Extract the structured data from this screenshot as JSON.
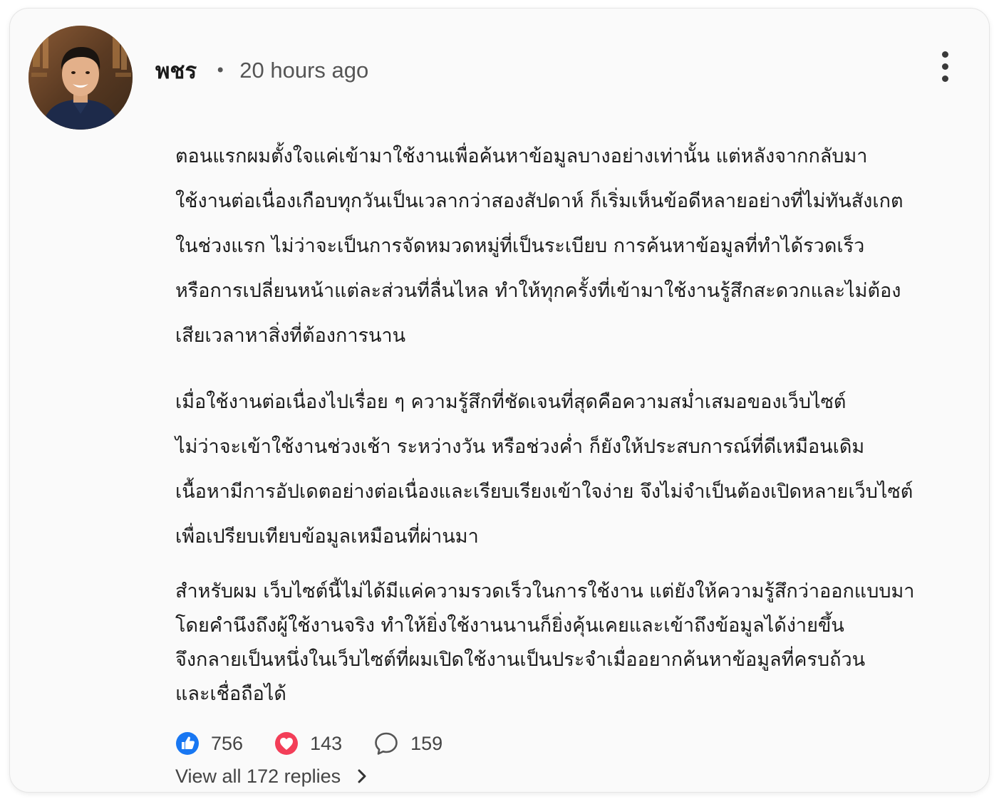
{
  "comment": {
    "author": "พชร",
    "separator": "•",
    "timestamp": "20 hours ago",
    "paragraphs": [
      [
        "ตอนแรกผมตั้งใจแค่เข้ามาใช้งานเพื่อค้นหาข้อมูลบางอย่างเท่านั้น แต่หลังจากกลับมา",
        "ใช้งานต่อเนื่องเกือบทุกวันเป็นเวลากว่าสองสัปดาห์ ก็เริ่มเห็นข้อดีหลายอย่างที่ไม่ทันสังเกต",
        "ในช่วงแรก ไม่ว่าจะเป็นการจัดหมวดหมู่ที่เป็นระเบียบ การค้นหาข้อมูลที่ทำได้รวดเร็ว",
        "หรือการเปลี่ยนหน้าแต่ละส่วนที่ลื่นไหล ทำให้ทุกครั้งที่เข้ามาใช้งานรู้สึกสะดวกและไม่ต้อง",
        "เสียเวลาหาสิ่งที่ต้องการนาน"
      ],
      [
        "เมื่อใช้งานต่อเนื่องไปเรื่อย ๆ ความรู้สึกที่ชัดเจนที่สุดคือความสม่ำเสมอของเว็บไซต์",
        "ไม่ว่าจะเข้าใช้งานช่วงเช้า ระหว่างวัน หรือช่วงค่ำ ก็ยังให้ประสบการณ์ที่ดีเหมือนเดิม",
        "เนื้อหามีการอัปเดตอย่างต่อเนื่องและเรียบเรียงเข้าใจง่าย จึงไม่จำเป็นต้องเปิดหลายเว็บไซต์",
        "เพื่อเปรียบเทียบข้อมูลเหมือนที่ผ่านมา"
      ],
      [
        "สำหรับผม เว็บไซต์นี้ไม่ได้มีแค่ความรวดเร็วในการใช้งาน แต่ยังให้ความรู้สึกว่าออกแบบมา",
        "โดยคำนึงถึงผู้ใช้งานจริง ทำให้ยิ่งใช้งานนานก็ยิ่งคุ้นเคยและเข้าถึงข้อมูลได้ง่ายขึ้น",
        "จึงกลายเป็นหนึ่งในเว็บไซต์ที่ผมเปิดใช้งานเป็นประจำเมื่ออยากค้นหาข้อมูลที่ครบถ้วน",
        "และเชื่อถือได้"
      ]
    ]
  },
  "reactions": {
    "like": {
      "icon": "thumbs-up-icon",
      "count": "756",
      "color": "#1877f2"
    },
    "love": {
      "icon": "heart-icon",
      "count": "143",
      "color": "#f33e58"
    },
    "reply": {
      "icon": "speech-bubble-icon",
      "count": "159"
    }
  },
  "view_replies": {
    "label": "View all 172 replies",
    "icon": "chevron-right-icon"
  }
}
